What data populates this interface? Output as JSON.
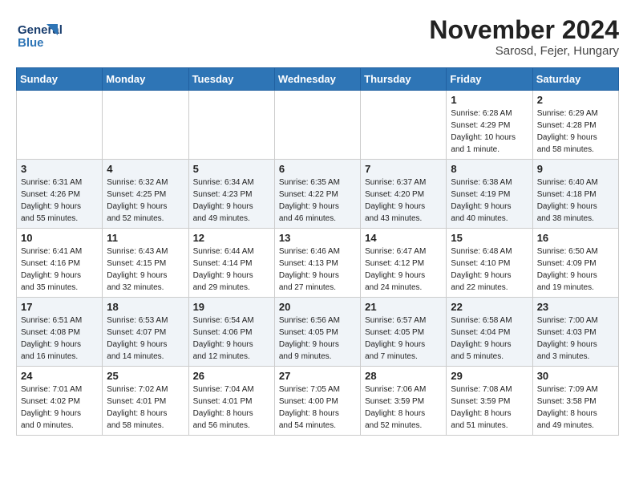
{
  "header": {
    "logo_line1": "General",
    "logo_line2": "Blue",
    "title": "November 2024",
    "subtitle": "Sarosd, Fejer, Hungary"
  },
  "weekdays": [
    "Sunday",
    "Monday",
    "Tuesday",
    "Wednesday",
    "Thursday",
    "Friday",
    "Saturday"
  ],
  "weeks": [
    [
      {
        "day": "",
        "info": ""
      },
      {
        "day": "",
        "info": ""
      },
      {
        "day": "",
        "info": ""
      },
      {
        "day": "",
        "info": ""
      },
      {
        "day": "",
        "info": ""
      },
      {
        "day": "1",
        "info": "Sunrise: 6:28 AM\nSunset: 4:29 PM\nDaylight: 10 hours\nand 1 minute."
      },
      {
        "day": "2",
        "info": "Sunrise: 6:29 AM\nSunset: 4:28 PM\nDaylight: 9 hours\nand 58 minutes."
      }
    ],
    [
      {
        "day": "3",
        "info": "Sunrise: 6:31 AM\nSunset: 4:26 PM\nDaylight: 9 hours\nand 55 minutes."
      },
      {
        "day": "4",
        "info": "Sunrise: 6:32 AM\nSunset: 4:25 PM\nDaylight: 9 hours\nand 52 minutes."
      },
      {
        "day": "5",
        "info": "Sunrise: 6:34 AM\nSunset: 4:23 PM\nDaylight: 9 hours\nand 49 minutes."
      },
      {
        "day": "6",
        "info": "Sunrise: 6:35 AM\nSunset: 4:22 PM\nDaylight: 9 hours\nand 46 minutes."
      },
      {
        "day": "7",
        "info": "Sunrise: 6:37 AM\nSunset: 4:20 PM\nDaylight: 9 hours\nand 43 minutes."
      },
      {
        "day": "8",
        "info": "Sunrise: 6:38 AM\nSunset: 4:19 PM\nDaylight: 9 hours\nand 40 minutes."
      },
      {
        "day": "9",
        "info": "Sunrise: 6:40 AM\nSunset: 4:18 PM\nDaylight: 9 hours\nand 38 minutes."
      }
    ],
    [
      {
        "day": "10",
        "info": "Sunrise: 6:41 AM\nSunset: 4:16 PM\nDaylight: 9 hours\nand 35 minutes."
      },
      {
        "day": "11",
        "info": "Sunrise: 6:43 AM\nSunset: 4:15 PM\nDaylight: 9 hours\nand 32 minutes."
      },
      {
        "day": "12",
        "info": "Sunrise: 6:44 AM\nSunset: 4:14 PM\nDaylight: 9 hours\nand 29 minutes."
      },
      {
        "day": "13",
        "info": "Sunrise: 6:46 AM\nSunset: 4:13 PM\nDaylight: 9 hours\nand 27 minutes."
      },
      {
        "day": "14",
        "info": "Sunrise: 6:47 AM\nSunset: 4:12 PM\nDaylight: 9 hours\nand 24 minutes."
      },
      {
        "day": "15",
        "info": "Sunrise: 6:48 AM\nSunset: 4:10 PM\nDaylight: 9 hours\nand 22 minutes."
      },
      {
        "day": "16",
        "info": "Sunrise: 6:50 AM\nSunset: 4:09 PM\nDaylight: 9 hours\nand 19 minutes."
      }
    ],
    [
      {
        "day": "17",
        "info": "Sunrise: 6:51 AM\nSunset: 4:08 PM\nDaylight: 9 hours\nand 16 minutes."
      },
      {
        "day": "18",
        "info": "Sunrise: 6:53 AM\nSunset: 4:07 PM\nDaylight: 9 hours\nand 14 minutes."
      },
      {
        "day": "19",
        "info": "Sunrise: 6:54 AM\nSunset: 4:06 PM\nDaylight: 9 hours\nand 12 minutes."
      },
      {
        "day": "20",
        "info": "Sunrise: 6:56 AM\nSunset: 4:05 PM\nDaylight: 9 hours\nand 9 minutes."
      },
      {
        "day": "21",
        "info": "Sunrise: 6:57 AM\nSunset: 4:05 PM\nDaylight: 9 hours\nand 7 minutes."
      },
      {
        "day": "22",
        "info": "Sunrise: 6:58 AM\nSunset: 4:04 PM\nDaylight: 9 hours\nand 5 minutes."
      },
      {
        "day": "23",
        "info": "Sunrise: 7:00 AM\nSunset: 4:03 PM\nDaylight: 9 hours\nand 3 minutes."
      }
    ],
    [
      {
        "day": "24",
        "info": "Sunrise: 7:01 AM\nSunset: 4:02 PM\nDaylight: 9 hours\nand 0 minutes."
      },
      {
        "day": "25",
        "info": "Sunrise: 7:02 AM\nSunset: 4:01 PM\nDaylight: 8 hours\nand 58 minutes."
      },
      {
        "day": "26",
        "info": "Sunrise: 7:04 AM\nSunset: 4:01 PM\nDaylight: 8 hours\nand 56 minutes."
      },
      {
        "day": "27",
        "info": "Sunrise: 7:05 AM\nSunset: 4:00 PM\nDaylight: 8 hours\nand 54 minutes."
      },
      {
        "day": "28",
        "info": "Sunrise: 7:06 AM\nSunset: 3:59 PM\nDaylight: 8 hours\nand 52 minutes."
      },
      {
        "day": "29",
        "info": "Sunrise: 7:08 AM\nSunset: 3:59 PM\nDaylight: 8 hours\nand 51 minutes."
      },
      {
        "day": "30",
        "info": "Sunrise: 7:09 AM\nSunset: 3:58 PM\nDaylight: 8 hours\nand 49 minutes."
      }
    ]
  ]
}
